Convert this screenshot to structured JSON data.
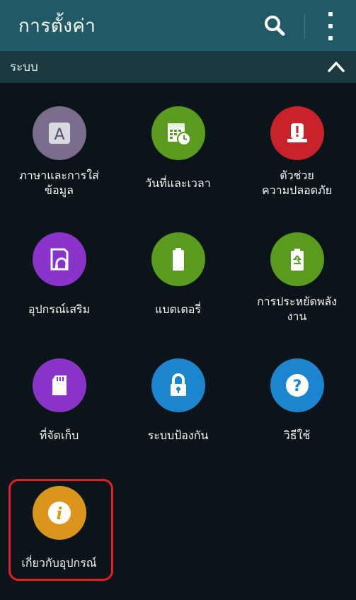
{
  "header": {
    "title": "การตั้งค่า",
    "search_icon": "search-icon",
    "menu_icon": "more-vertical-icon"
  },
  "section": {
    "label": "ระบบ",
    "toggle_icon": "chevron-up-icon"
  },
  "colors": {
    "appbar": "#1f5a66",
    "section": "#1c3940",
    "background": "#0b1418",
    "highlight": "#e31e24",
    "language": "#7b6d8c",
    "datetime": "#5a9a1e",
    "safety": "#c9222a",
    "accessories": "#8a33c9",
    "battery": "#5a9a1e",
    "power_saving": "#5a9a1e",
    "storage": "#8a33c9",
    "security": "#1b86cf",
    "help": "#1b86cf",
    "about": "#d9951c"
  },
  "items": [
    {
      "label": "ภาษาและการใส่\nข้อมูล",
      "icon": "language-input-icon"
    },
    {
      "label": "วันที่และเวลา",
      "icon": "calendar-clock-icon"
    },
    {
      "label": "ตัวช่วย\nความปลอดภัย",
      "icon": "safety-alert-icon"
    },
    {
      "label": "อุปกรณ์เสริม",
      "icon": "accessory-icon"
    },
    {
      "label": "แบตเตอรี่",
      "icon": "battery-icon"
    },
    {
      "label": "การประหยัดพลัง\nงาน",
      "icon": "power-saving-icon"
    },
    {
      "label": "ที่จัดเก็บ",
      "icon": "sd-card-icon"
    },
    {
      "label": "ระบบป้องกัน",
      "icon": "lock-icon"
    },
    {
      "label": "วิธีใช้",
      "icon": "help-icon"
    },
    {
      "label": "เกี่ยวกับอุปกรณ์",
      "icon": "info-icon"
    }
  ]
}
